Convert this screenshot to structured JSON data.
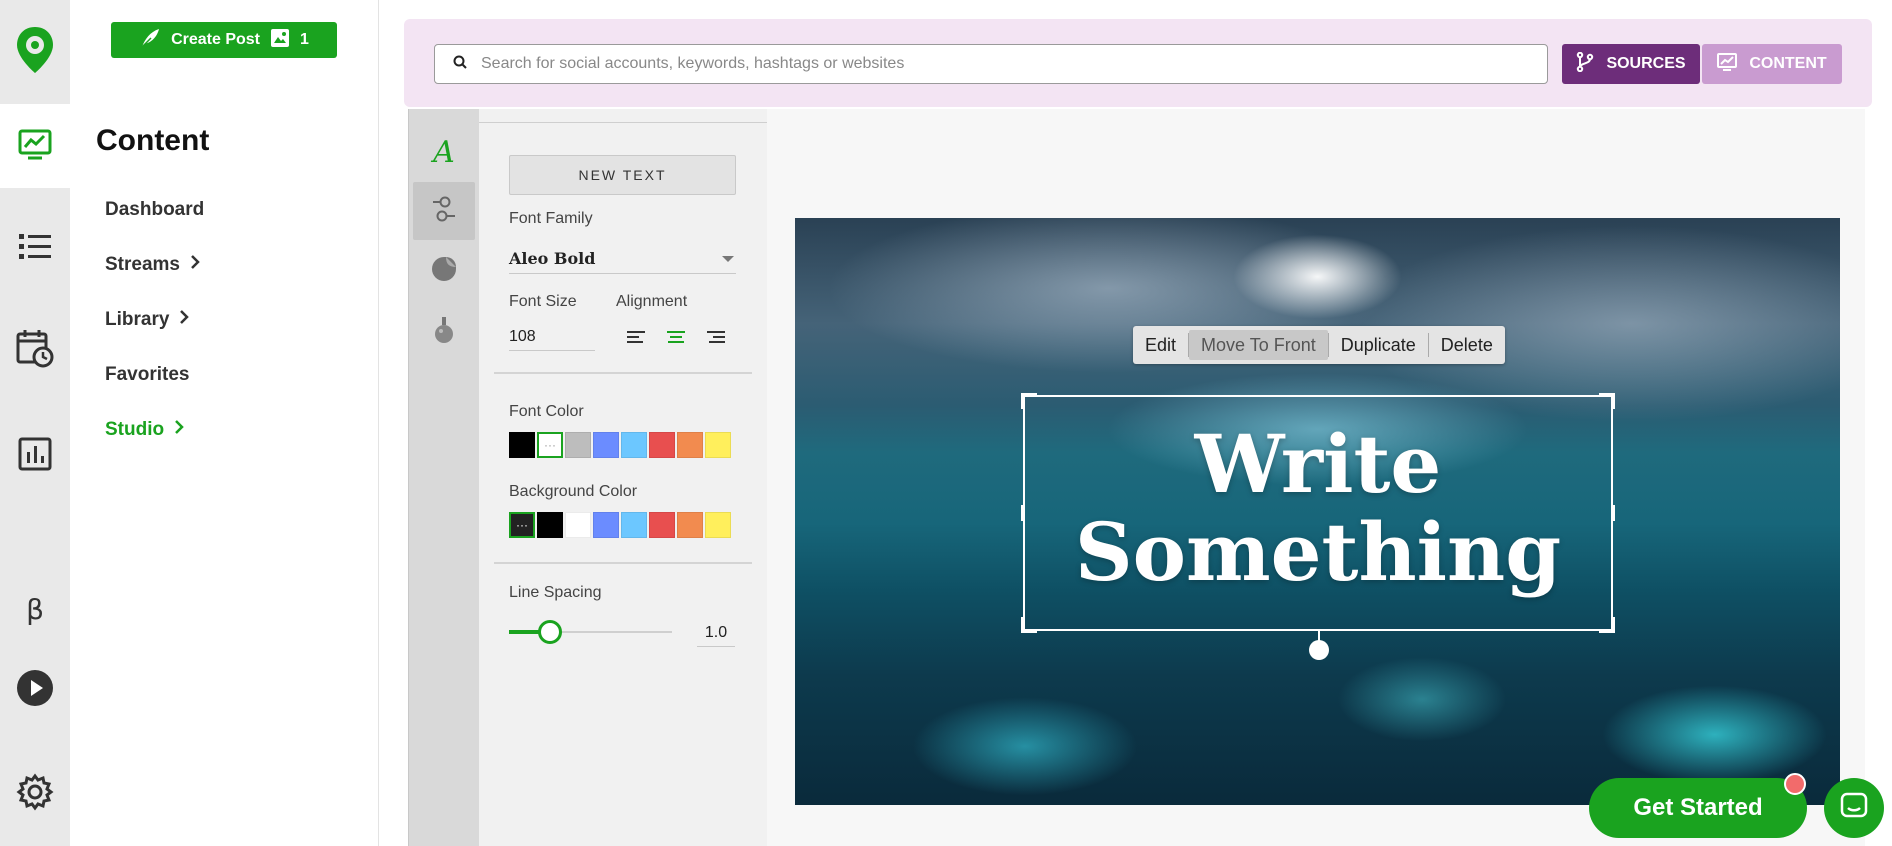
{
  "nav": {
    "create_post_label": "Create Post",
    "create_post_count": "1",
    "title": "Content",
    "links": [
      {
        "label": "Dashboard"
      },
      {
        "label": "Streams"
      },
      {
        "label": "Library"
      },
      {
        "label": "Favorites"
      },
      {
        "label": "Studio"
      }
    ]
  },
  "rail": {
    "icons": [
      "logo-pin-icon",
      "content-chart-icon",
      "list-icon",
      "calendar-clock-icon",
      "bar-chart-icon",
      "beta-icon",
      "play-icon",
      "gear-icon"
    ],
    "beta_glyph": "β"
  },
  "topbar": {
    "search_placeholder": "Search for social accounts, keywords, hashtags or websites",
    "sources_label": "SOURCES",
    "content_label": "CONTENT"
  },
  "panel": {
    "new_text_label": "NEW TEXT",
    "font_family_label": "Font Family",
    "font_family_value": "Aleo Bold",
    "font_size_label": "Font Size",
    "font_size_value": "108",
    "alignment_label": "Alignment",
    "alignment_selected": "center",
    "font_color_label": "Font Color",
    "font_colors": [
      "#000000",
      "none",
      "#bdbdbd",
      "#6b8cff",
      "#6cc7ff",
      "#e84f4f",
      "#f28b4f",
      "#ffef5c"
    ],
    "background_color_label": "Background Color",
    "background_colors": [
      "none",
      "#000000",
      "#ffffff",
      "#6b8cff",
      "#6cc7ff",
      "#e84f4f",
      "#f28b4f",
      "#ffef5c"
    ],
    "line_spacing_label": "Line Spacing",
    "line_spacing_value": "1.0",
    "line_spacing_fraction": 0.25
  },
  "canvas": {
    "toolbar": {
      "edit": "Edit",
      "move_to_front": "Move To Front",
      "duplicate": "Duplicate",
      "delete": "Delete"
    },
    "text_line1": "Write",
    "text_line2": "Something"
  },
  "widgets": {
    "get_started_label": "Get Started"
  },
  "colors": {
    "brand_green": "#1aa31f",
    "sources_purple": "#6d2d7a",
    "content_purple": "#c99bd0",
    "topbar_bg": "#f3e4f3"
  }
}
